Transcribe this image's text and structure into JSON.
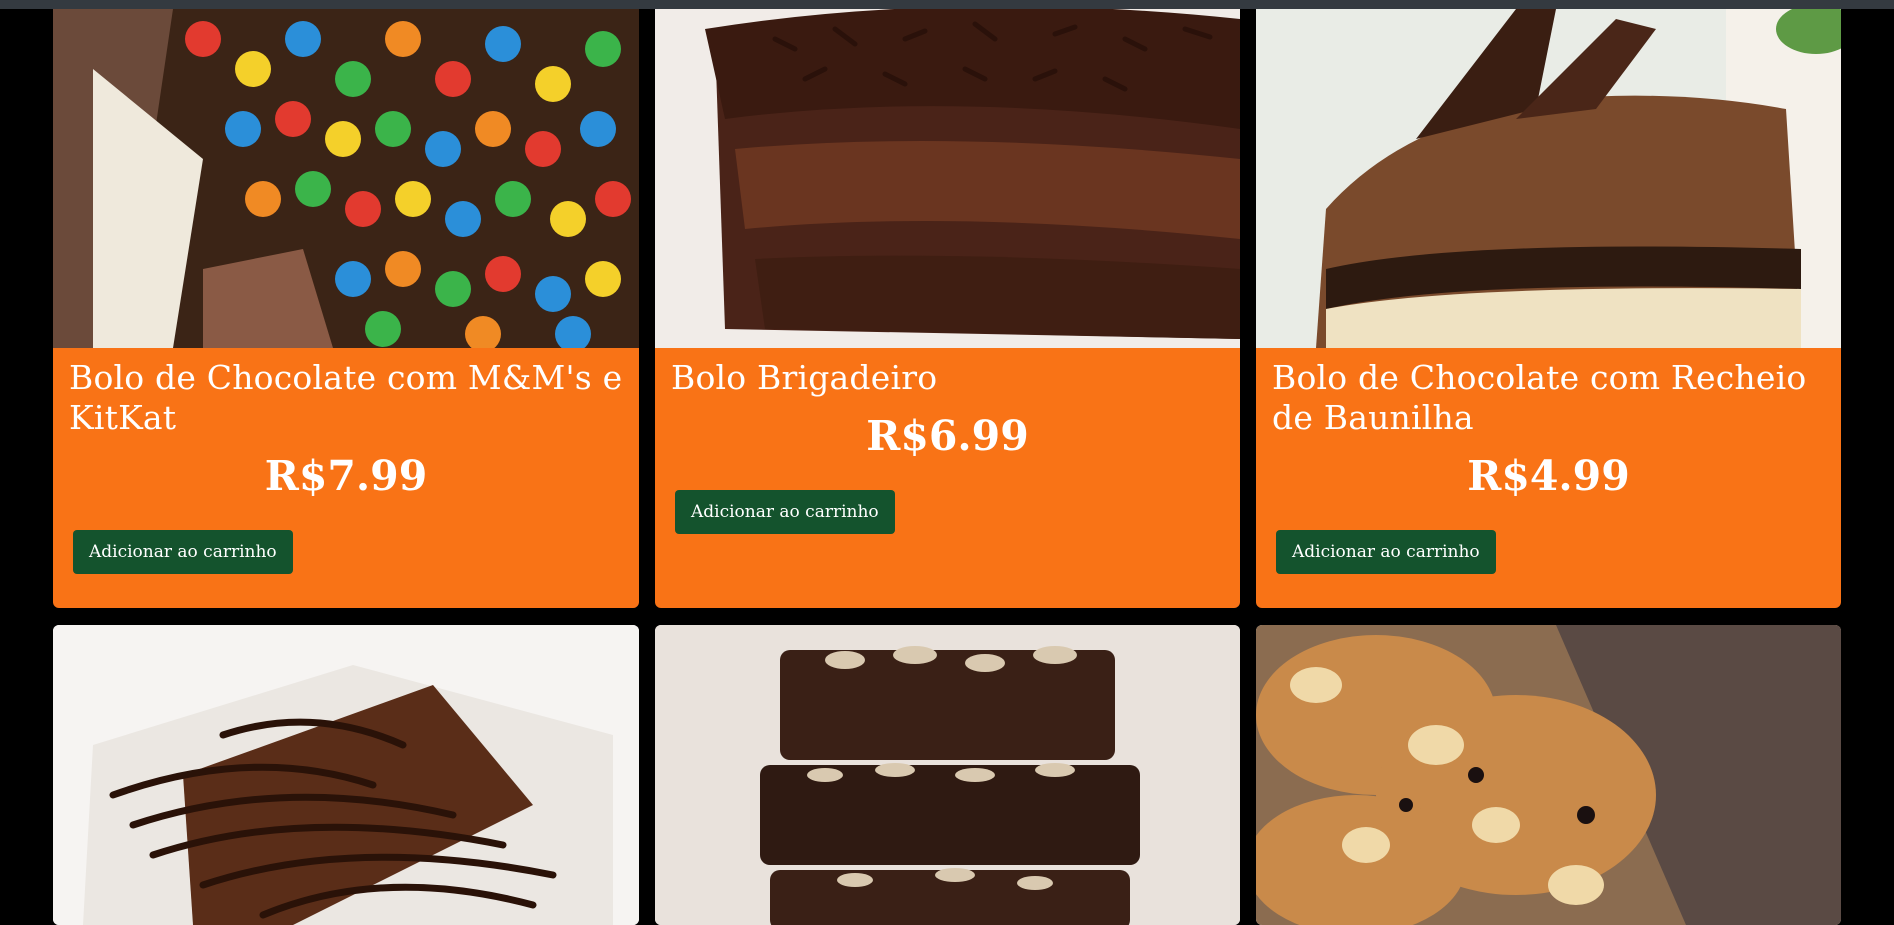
{
  "products": [
    {
      "title": "Bolo de Chocolate com M&M's e KitKat",
      "price": "R$7.99",
      "button": "Adicionar ao carrinho",
      "image": "cake-mms-kitkat-photo"
    },
    {
      "title": "Bolo Brigadeiro",
      "price": "R$6.99",
      "button": "Adicionar ao carrinho",
      "image": "brigadeiro-cake-photo"
    },
    {
      "title": "Bolo de Chocolate com Recheio de Baunilha",
      "price": "R$4.99",
      "button": "Adicionar ao carrinho",
      "image": "chocolate-vanilla-cake-photo"
    },
    {
      "image": "brownie-chocolate-drizzle-photo"
    },
    {
      "image": "stacked-almond-brownies-photo"
    },
    {
      "image": "peanut-cookie-bar-photo"
    }
  ],
  "colors": {
    "card": "#f97316",
    "button": "#14532d",
    "page": "#000000",
    "topbar": "#343a40"
  }
}
